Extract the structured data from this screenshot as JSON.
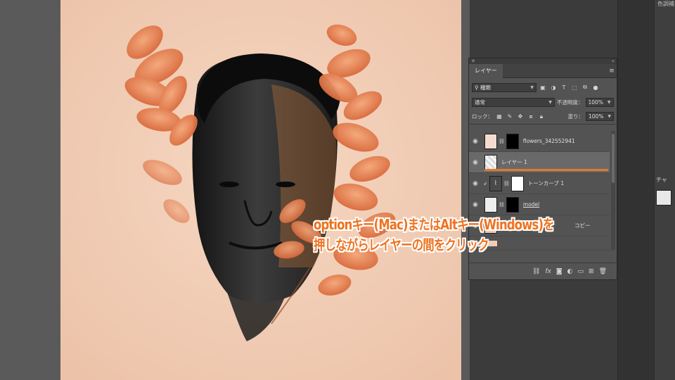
{
  "caption": {
    "line1": "optionキー(Mac)またはAltキー(Windows)を",
    "line2": "押しながらレイヤーの間をクリック"
  },
  "right_strip": {
    "top_label": "色調補",
    "channel_label": "チャ"
  },
  "layers_panel": {
    "tab": "レイヤー",
    "filter": {
      "label": "種類"
    },
    "blend_mode": "通常",
    "opacity_label": "不透明度：",
    "opacity_value": "100%",
    "lock_label": "ロック：",
    "fill_label": "塗り：",
    "fill_value": "100%",
    "layers": [
      {
        "name": "flowers_342552941",
        "visible": true,
        "selected": false
      },
      {
        "name": "レイヤー 1",
        "visible": true,
        "selected": true
      },
      {
        "name": "トーンカーブ 1",
        "visible": true,
        "selected": false
      },
      {
        "name": "model",
        "visible": true,
        "selected": false
      },
      {
        "name": "コピー",
        "visible": true,
        "selected": false
      }
    ],
    "bottom_icons": [
      "link-icon",
      "fx-icon",
      "mask-icon",
      "adjustment-icon",
      "folder-icon",
      "new-layer-icon",
      "trash-icon"
    ],
    "fx_label": "fx"
  },
  "colors": {
    "accent": "#ee7320",
    "canvas_bg": "#f2cdb6",
    "flower": "#e8875a",
    "panel_bg": "#535353"
  }
}
